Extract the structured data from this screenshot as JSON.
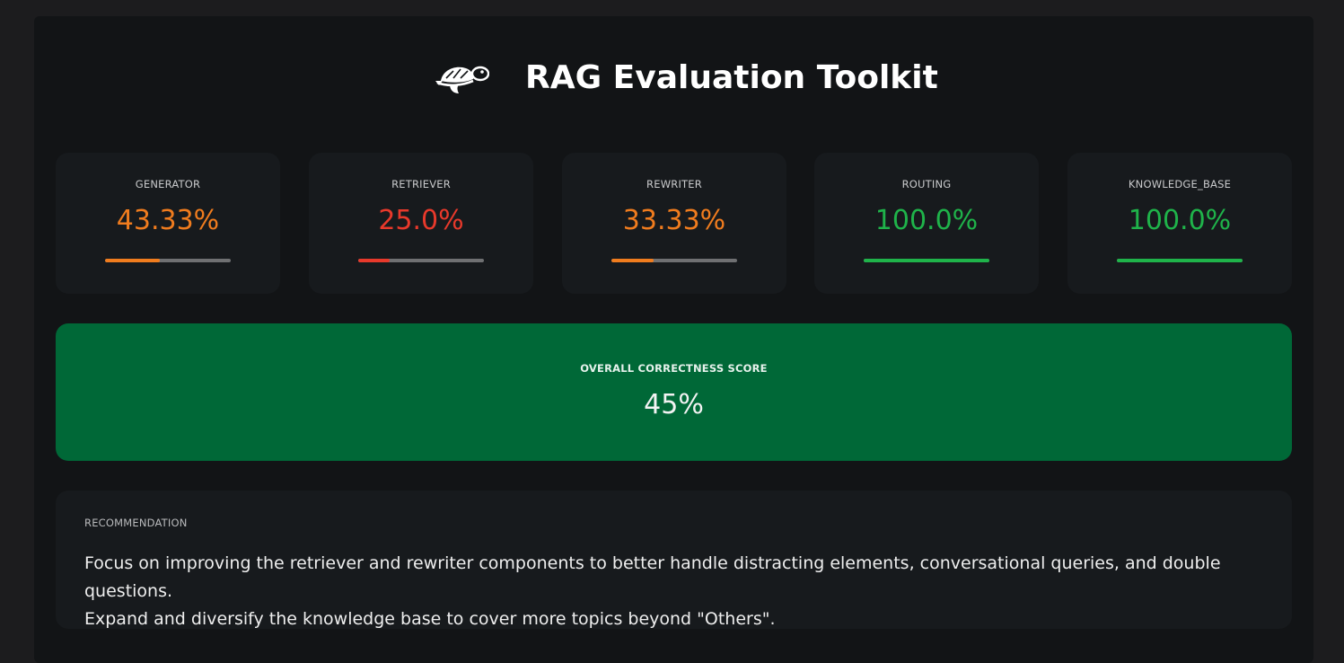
{
  "header": {
    "title": "RAG Evaluation Toolkit",
    "logo_icon": "turtle-icon"
  },
  "metrics": [
    {
      "label": "GENERATOR",
      "value": "43.33%",
      "fraction": 0.4333,
      "color": "#f07c1e"
    },
    {
      "label": "RETRIEVER",
      "value": "25.0%",
      "fraction": 0.25,
      "color": "#e8392b"
    },
    {
      "label": "REWRITER",
      "value": "33.33%",
      "fraction": 0.3333,
      "color": "#f07c1e"
    },
    {
      "label": "ROUTING",
      "value": "100.0%",
      "fraction": 1.0,
      "color": "#1fb34a"
    },
    {
      "label": "KNOWLEDGE_BASE",
      "value": "100.0%",
      "fraction": 1.0,
      "color": "#1fb34a"
    }
  ],
  "overall": {
    "label": "OVERALL CORRECTNESS SCORE",
    "value": "45%",
    "color": "#006837"
  },
  "recommendation": {
    "label": "RECOMMENDATION",
    "text_line1": "Focus on improving the retriever and rewriter components to better handle distracting elements, conversational queries, and double questions.",
    "text_line2": "Expand and diversify the knowledge base to cover more topics beyond \"Others\"."
  }
}
